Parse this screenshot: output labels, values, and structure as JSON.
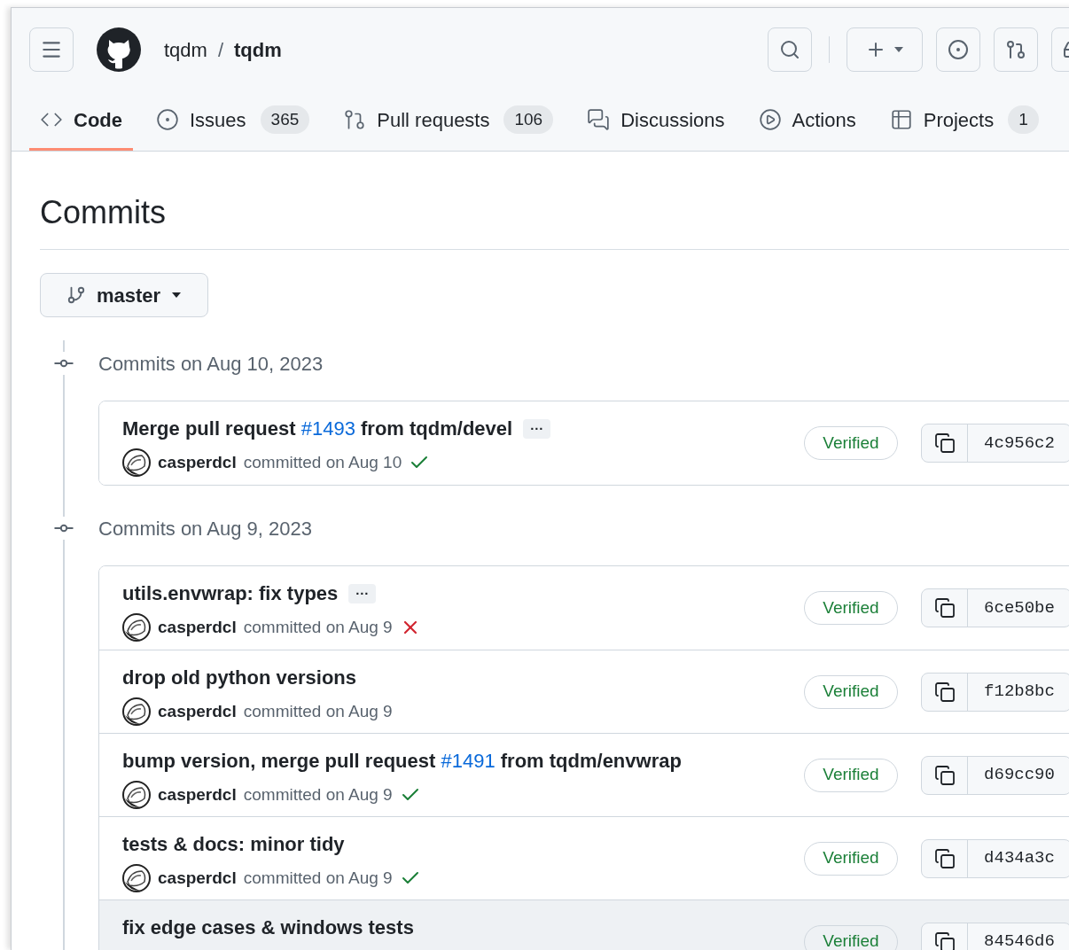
{
  "header": {
    "owner": "tqdm",
    "separator": "/",
    "repo": "tqdm"
  },
  "tabs": [
    {
      "label": "Code",
      "kind": "code",
      "selected": true
    },
    {
      "label": "Issues",
      "kind": "issue",
      "count": "365",
      "selected": false
    },
    {
      "label": "Pull requests",
      "kind": "pull",
      "count": "106",
      "selected": false
    },
    {
      "label": "Discussions",
      "kind": "discussion",
      "selected": false
    },
    {
      "label": "Actions",
      "kind": "play",
      "selected": false
    },
    {
      "label": "Projects",
      "kind": "table",
      "count": "1",
      "selected": false
    }
  ],
  "page_title": "Commits",
  "branch": {
    "name": "master"
  },
  "groups": [
    {
      "heading": "Commits on Aug 10, 2023",
      "commits": [
        {
          "title": [
            {
              "kind": "text",
              "text": "Merge pull request"
            },
            {
              "kind": "link",
              "text": "#1493"
            },
            {
              "kind": "text",
              "text": "from tqdm/devel"
            }
          ],
          "more": "···",
          "author": "casperdcl",
          "meta": "committed on Aug 10",
          "kind": "passed",
          "badge": "Verified",
          "hash": "4c956c2",
          "highlighted": false
        }
      ]
    },
    {
      "heading": "Commits on Aug 9, 2023",
      "commits": [
        {
          "title": [
            {
              "kind": "text",
              "text": "utils.envwrap: fix types"
            }
          ],
          "more": "···",
          "author": "casperdcl",
          "meta": "committed on Aug 9",
          "kind": "failed",
          "badge": "Verified",
          "hash": "6ce50be",
          "highlighted": false
        },
        {
          "title": [
            {
              "kind": "text",
              "text": "drop old python versions"
            }
          ],
          "author": "casperdcl",
          "meta": "committed on Aug 9",
          "kind": "plain",
          "badge": "Verified",
          "hash": "f12b8bc",
          "highlighted": false
        },
        {
          "title": [
            {
              "kind": "text",
              "text": "bump version, merge pull request"
            },
            {
              "kind": "link",
              "text": "#1491"
            },
            {
              "kind": "text",
              "text": "from tqdm/envwrap"
            }
          ],
          "author": "casperdcl",
          "meta": "committed on Aug 9",
          "kind": "passed",
          "badge": "Verified",
          "hash": "d69cc90",
          "highlighted": false
        },
        {
          "title": [
            {
              "kind": "text",
              "text": "tests & docs: minor tidy"
            }
          ],
          "author": "casperdcl",
          "meta": "committed on Aug 9",
          "kind": "passed",
          "badge": "Verified",
          "hash": "d434a3c",
          "highlighted": false
        },
        {
          "title": [
            {
              "kind": "text",
              "text": "fix edge cases & windows tests"
            }
          ],
          "badge": "Verified",
          "hash": "84546d6",
          "highlighted": true
        }
      ]
    }
  ]
}
